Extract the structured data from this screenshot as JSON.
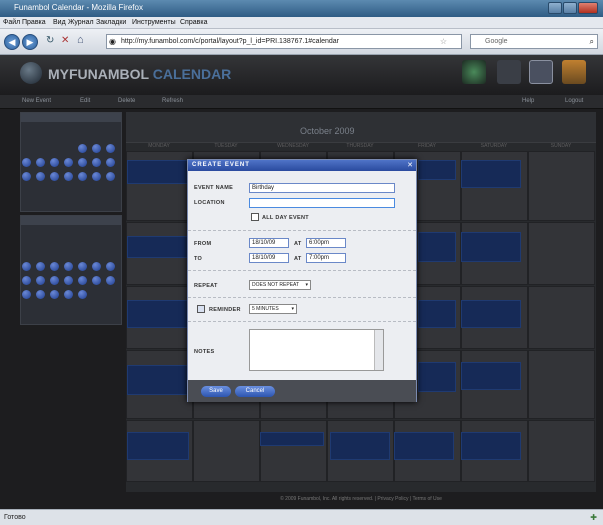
{
  "browser": {
    "title": "Funambol Calendar - Mozilla Firefox",
    "menu": [
      "Файл",
      "Правка",
      "Вид",
      "Журнал",
      "Закладки",
      "Инструменты",
      "Справка"
    ],
    "url": "http://my.funambol.com/c/portal/layout?p_l_id=PRI.138767.1#calendar",
    "search_engine": "Google",
    "status_text": "Готово"
  },
  "app": {
    "brand_main": "MYFUNAMBOL",
    "brand_accent": "CALENDAR",
    "toolbar": [
      "New Event",
      "Edit",
      "Delete",
      "Refresh"
    ],
    "toolbar_right": [
      "Help",
      "Logout"
    ],
    "month_label": "October 2009",
    "day_headers": [
      "MONDAY",
      "TUESDAY",
      "WEDNESDAY",
      "THURSDAY",
      "FRIDAY",
      "SATURDAY",
      "SUNDAY"
    ],
    "footer": "© 2009 Funambol, Inc. All rights reserved. | Privacy Policy | Terms of Use"
  },
  "dialog": {
    "title": "CREATE EVENT",
    "event_name_label": "EVENT NAME",
    "event_name_value": "Birthday",
    "location_label": "LOCATION",
    "location_value": "",
    "all_day_label": "ALL DAY EVENT",
    "from_label": "FROM",
    "from_date": "18/10/09",
    "from_at": "AT",
    "from_time": "6:00pm",
    "to_label": "TO",
    "to_date": "18/10/09",
    "to_at": "AT",
    "to_time": "7:00pm",
    "repeat_label": "REPEAT",
    "repeat_value": "DOES NOT REPEAT",
    "reminder_label": "REMINDER",
    "reminder_value": "5 MINUTES",
    "notes_label": "NOTES",
    "notes_value": "",
    "save_label": "Save",
    "cancel_label": "Cancel"
  },
  "colors": {
    "accent": "#2d55b0",
    "event_block": "#1e3d80",
    "app_bg": "#1d1d1f"
  }
}
